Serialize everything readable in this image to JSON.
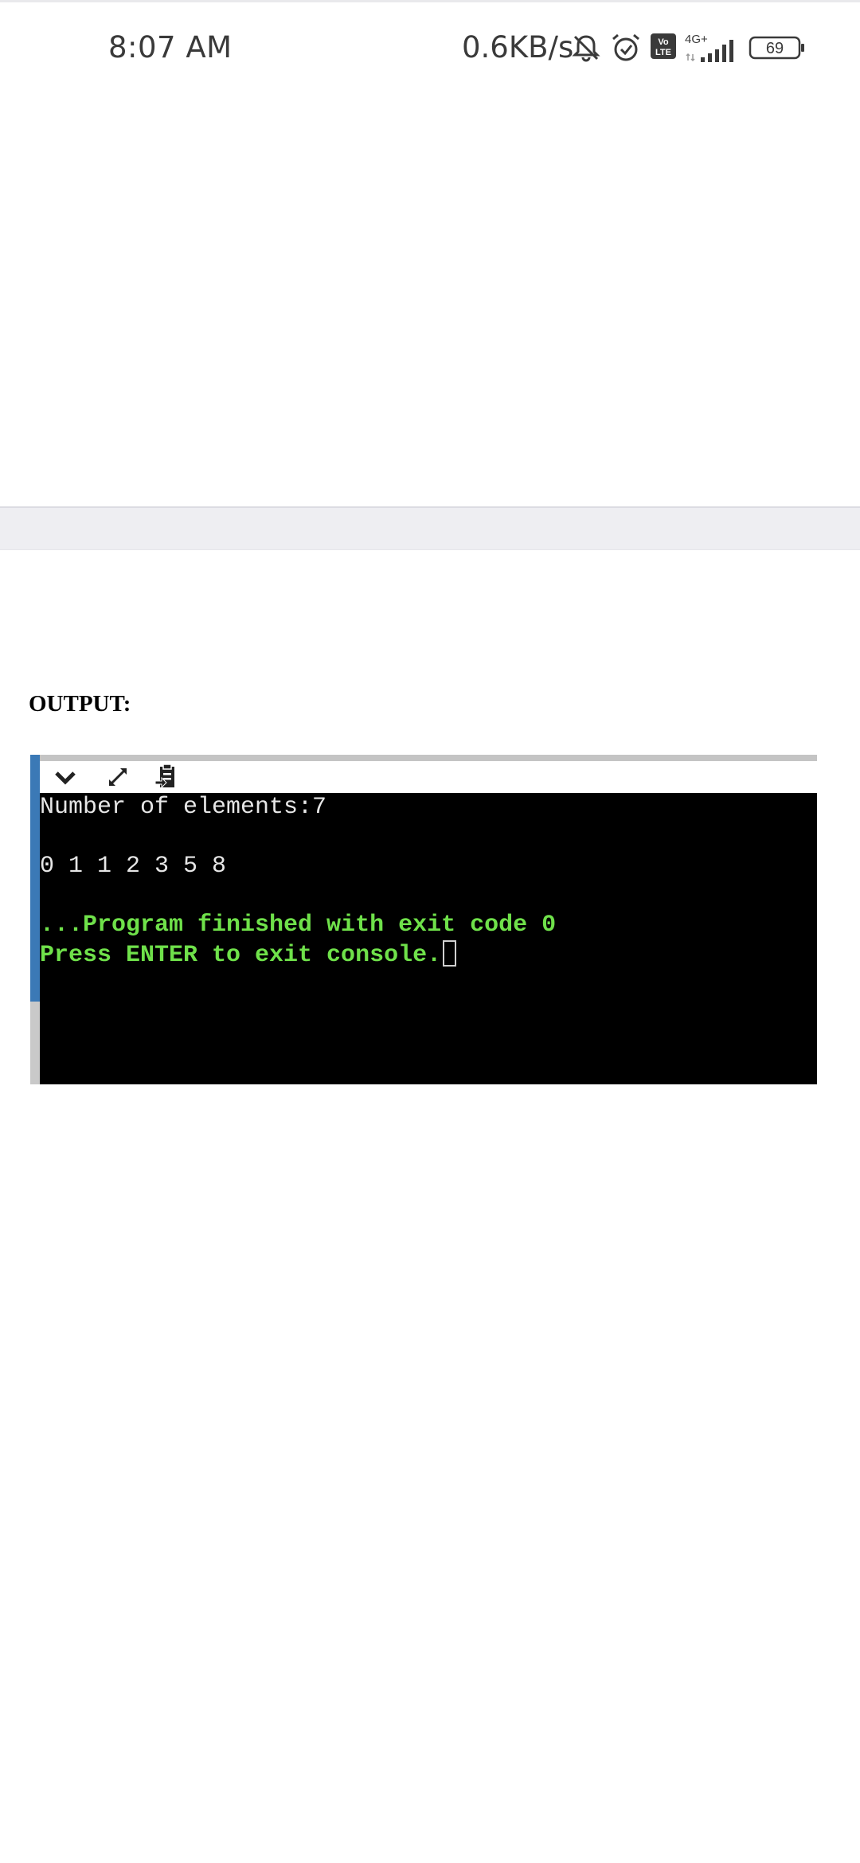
{
  "status_bar": {
    "time": "8:07 AM",
    "net_speed": "0.6KB/s",
    "network_type": "4G+",
    "volte": "Vo LTE",
    "battery_level": "69",
    "icons": [
      "bell-off-icon",
      "alarm-icon",
      "volte-icon",
      "signal-icon",
      "battery-icon"
    ]
  },
  "content": {
    "output_heading": "OUTPUT:"
  },
  "console": {
    "toolbar": {
      "icons": [
        "chevron-down-icon",
        "expand-icon",
        "copy-icon"
      ]
    },
    "lines": {
      "line1": "Number of elements:7",
      "line2": "0 1 1 2 3 5 8",
      "line3": "...Program finished with exit code 0",
      "line4": "Press ENTER to exit console."
    },
    "colors": {
      "background": "#000000",
      "output_text": "#e6e6e6",
      "status_text": "#6fe14a",
      "accent_strip": "#3b79b6"
    }
  }
}
